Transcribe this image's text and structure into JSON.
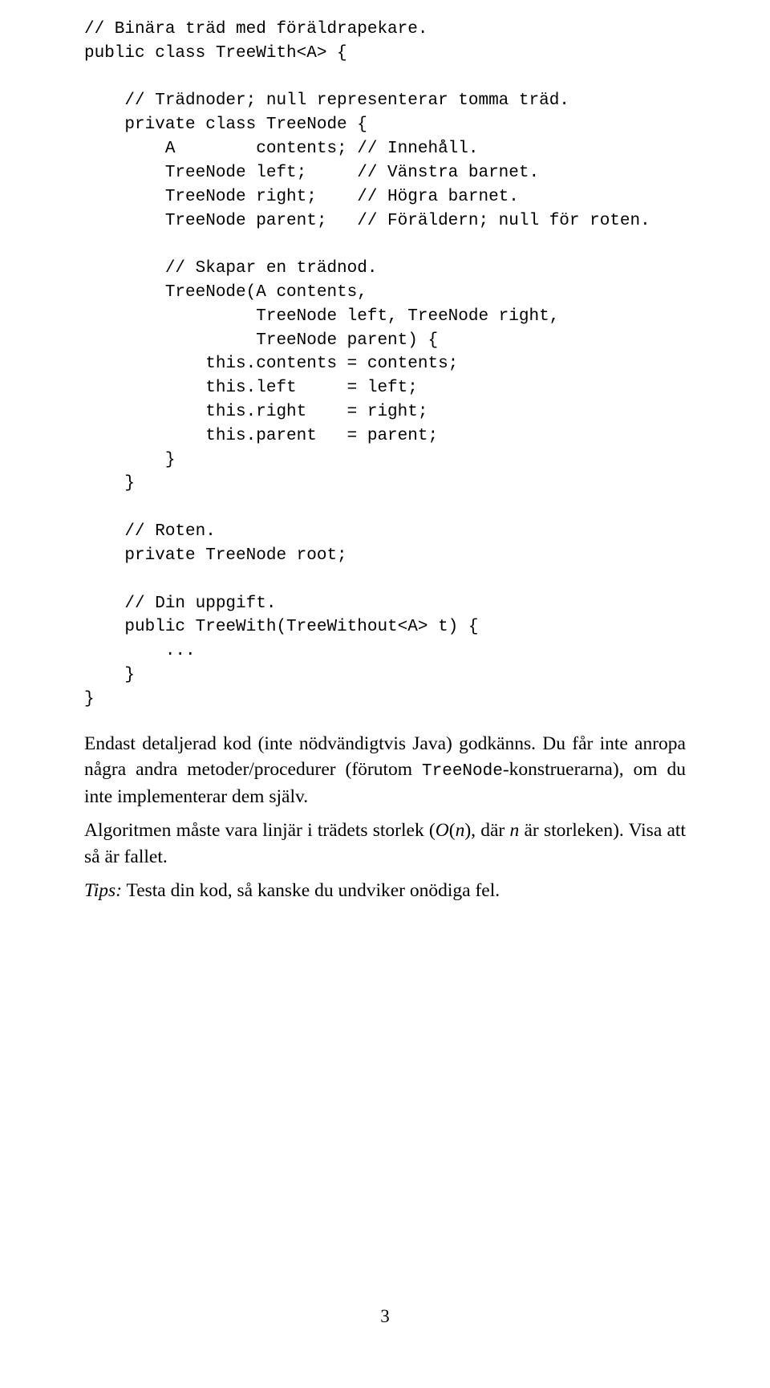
{
  "code": {
    "l1": "// Binära träd med föräldrapekare.",
    "l2": "public class TreeWith<A> {",
    "l3": "",
    "l4": "    // Trädnoder; null representerar tomma träd.",
    "l5": "    private class TreeNode {",
    "l6": "        A        contents; // Innehåll.",
    "l7": "        TreeNode left;     // Vänstra barnet.",
    "l8": "        TreeNode right;    // Högra barnet.",
    "l9": "        TreeNode parent;   // Föräldern; null för roten.",
    "l10": "",
    "l11": "        // Skapar en trädnod.",
    "l12": "        TreeNode(A contents,",
    "l13": "                 TreeNode left, TreeNode right,",
    "l14": "                 TreeNode parent) {",
    "l15": "            this.contents = contents;",
    "l16": "            this.left     = left;",
    "l17": "            this.right    = right;",
    "l18": "            this.parent   = parent;",
    "l19": "        }",
    "l20": "    }",
    "l21": "",
    "l22": "    // Roten.",
    "l23": "    private TreeNode root;",
    "l24": "",
    "l25": "    // Din uppgift.",
    "l26": "    public TreeWith(TreeWithout<A> t) {",
    "l27": "        ...",
    "l28": "    }",
    "l29": "}"
  },
  "prose": {
    "p1a": "Endast detaljerad kod (inte nödvändigtvis Java) godkänns. Du får inte anropa några andra metoder/procedurer (förutom ",
    "p1b": "TreeNode",
    "p1c": "-konstruerarna), om du inte implementerar dem själv.",
    "p2a": "Algoritmen måste vara linjär i trädets storlek (",
    "p2b": "O",
    "p2c": "(",
    "p2d": "n",
    "p2e": "), där ",
    "p2f": "n",
    "p2g": " är storleken). Visa att så är fallet.",
    "p3a": "Tips:",
    "p3b": " Testa din kod, så kanske du undviker onödiga fel."
  },
  "page_number": "3"
}
